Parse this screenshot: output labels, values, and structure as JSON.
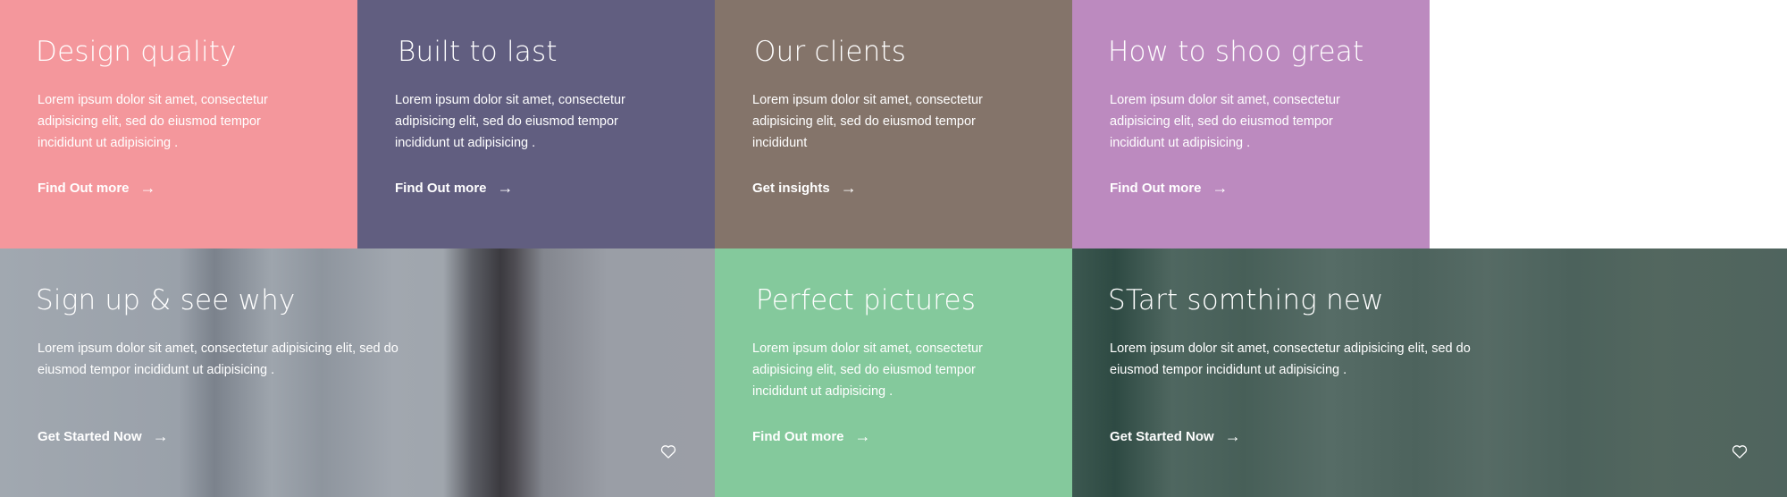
{
  "tiles": [
    {
      "title": "Design quality",
      "text": "Lorem ipsum dolor sit amet, consectetur adipisicing elit, sed do eiusmod tempor incididunt ut adipisicing .",
      "cta": "Find Out more",
      "arrow": "→",
      "color": "#f4979c"
    },
    {
      "title": "Built to last",
      "text": "Lorem ipsum dolor sit amet, consectetur adipisicing elit, sed do eiusmod tempor incididunt ut adipisicing .",
      "cta": "Find Out more",
      "arrow": "→",
      "color": "#615e80"
    },
    {
      "title": "Our clients",
      "text": "Lorem ipsum dolor sit amet, consectetur adipisicing elit, sed do eiusmod tempor incididunt",
      "cta": "Get insights",
      "arrow": "→",
      "color": "#84746a"
    },
    {
      "title": "How to shoo great",
      "text": "Lorem ipsum dolor sit amet, consectetur adipisicing elit, sed do eiusmod tempor incididunt ut adipisicing .",
      "cta": "Find Out more",
      "arrow": "→",
      "color": "#bc8abf"
    },
    {
      "title": "Sign up & see why",
      "text": "Lorem ipsum dolor sit amet, consectetur adipisicing elit, sed do eiusmod tempor incididunt ut adipisicing .",
      "cta": "Get Started Now",
      "arrow": "→",
      "icon": "heart-icon"
    },
    {
      "title": "Perfect pictures",
      "text": "Lorem ipsum dolor sit amet, consectetur adipisicing elit, sed do eiusmod tempor incididunt ut adipisicing .",
      "cta": "Find Out more",
      "arrow": "→",
      "color": "#84c99c"
    },
    {
      "title": "STart somthing new",
      "text": "Lorem ipsum dolor sit amet, consectetur adipisicing elit, sed do eiusmod tempor incididunt ut adipisicing .",
      "cta": "Get Started Now",
      "arrow": "→",
      "icon": "heart-icon"
    }
  ]
}
